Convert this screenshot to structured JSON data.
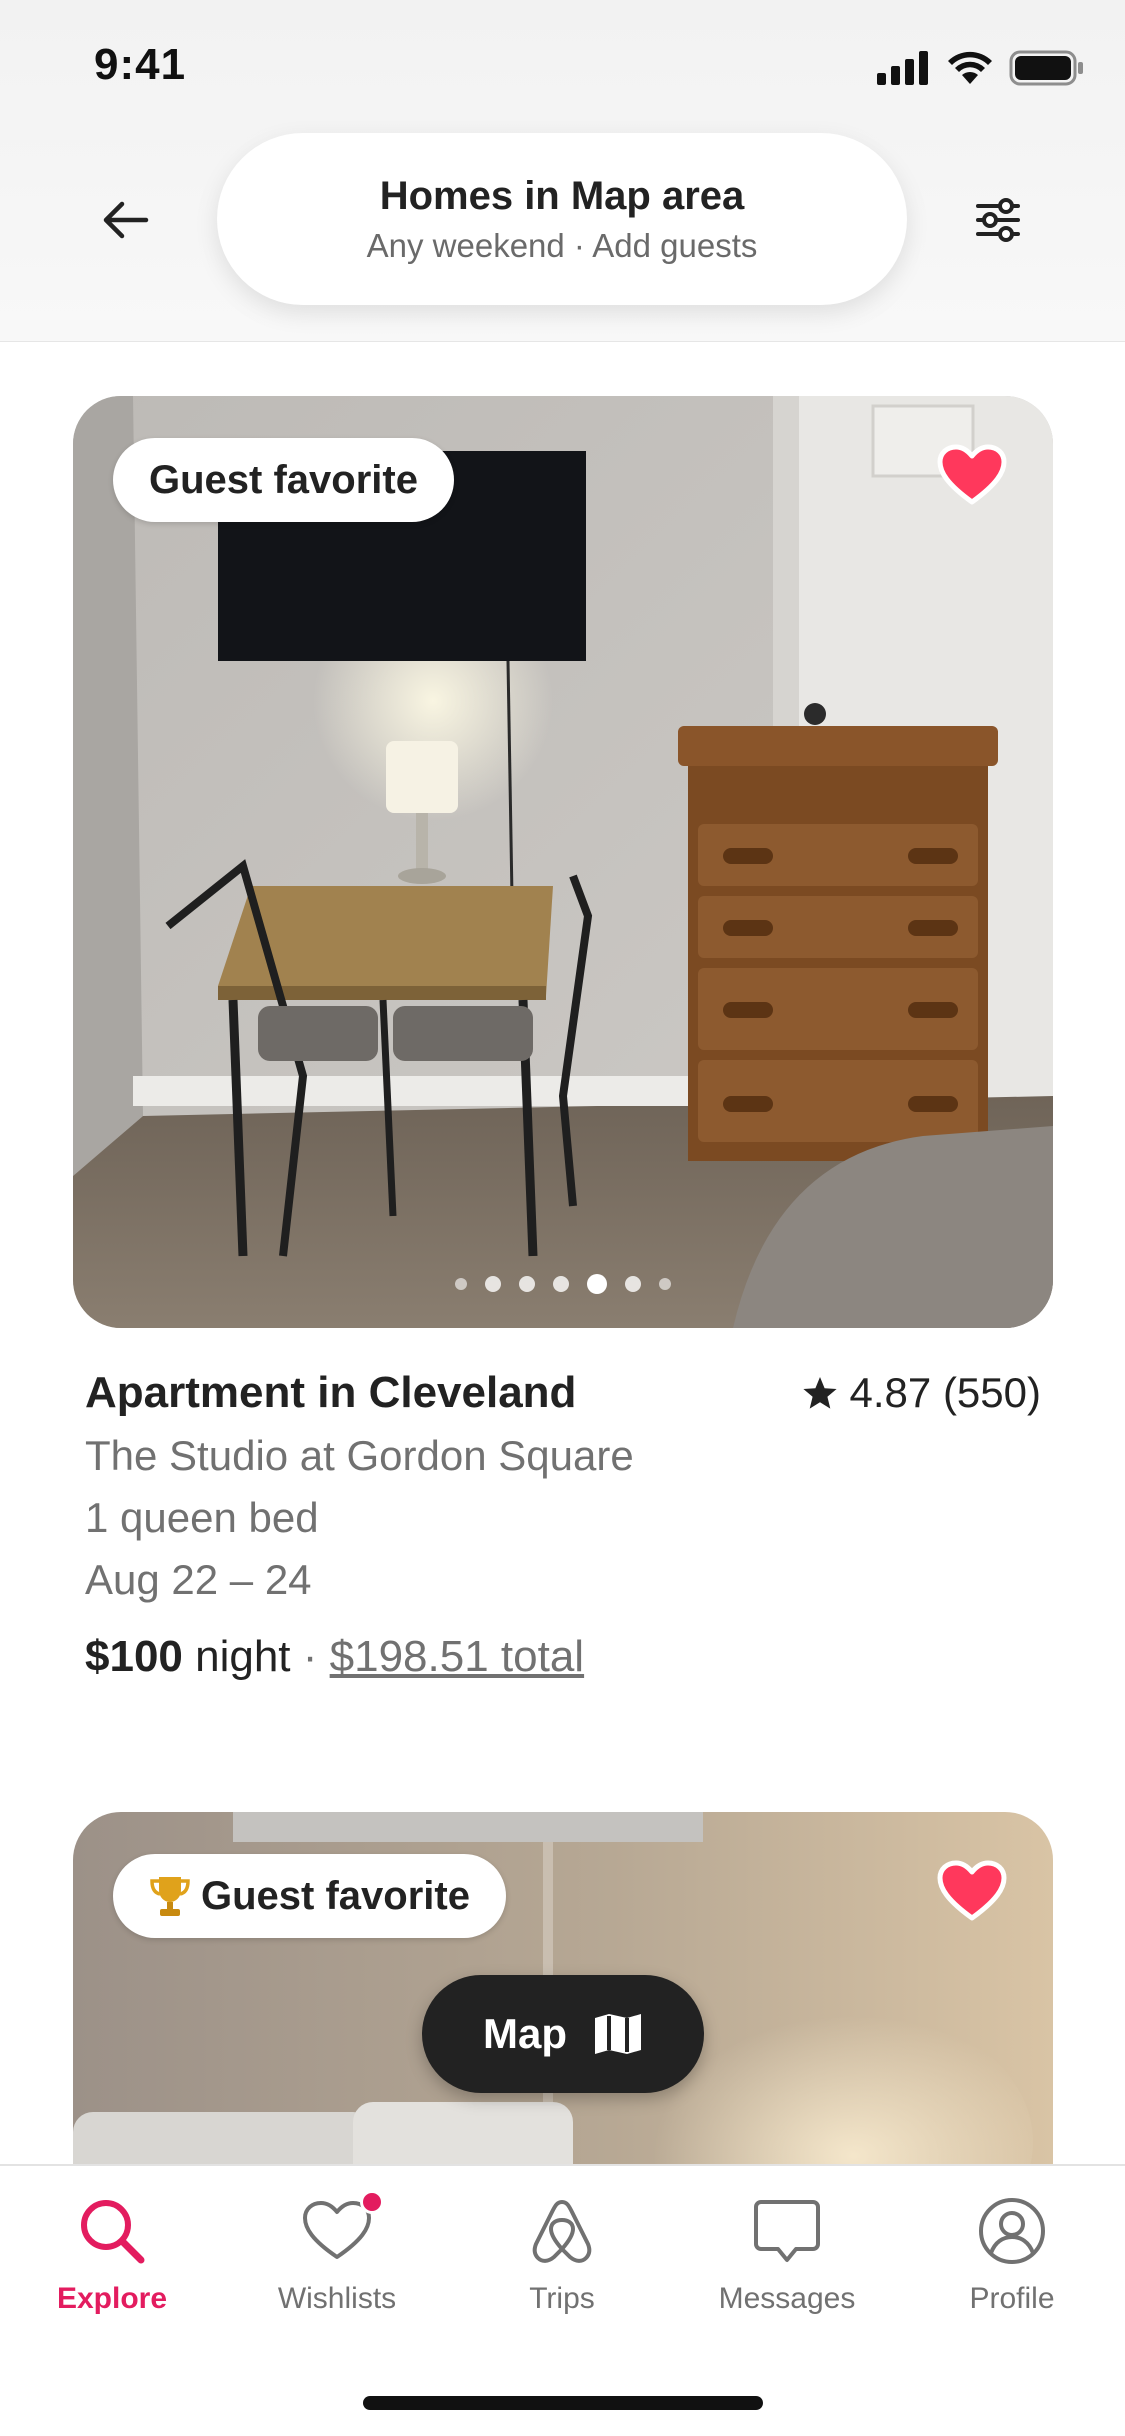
{
  "status_bar": {
    "time": "9:41"
  },
  "header": {
    "title": "Homes in Map area",
    "subtitle": "Any weekend · Add guests"
  },
  "listings": [
    {
      "badge": "Guest favorite",
      "badge_icon": "",
      "favorited": true,
      "photo_count": 7,
      "active_photo": 4,
      "title": "Apartment in Cleveland",
      "rating": "4.87 (550)",
      "name": "The Studio at Gordon Square",
      "beds": "1 queen bed",
      "dates": "Aug 22 – 24",
      "price": "$100",
      "price_unit": " night",
      "separator": " · ",
      "total": "$198.51 total"
    },
    {
      "badge": "Guest favorite",
      "badge_icon": "trophy-icon",
      "favorited": true
    }
  ],
  "map_button": {
    "label": "Map"
  },
  "tabs": [
    {
      "label": "Explore",
      "icon": "search-icon",
      "active": true
    },
    {
      "label": "Wishlists",
      "icon": "heart-icon",
      "active": false,
      "notification": true
    },
    {
      "label": "Trips",
      "icon": "airbnb-logo-icon",
      "active": false
    },
    {
      "label": "Messages",
      "icon": "message-icon",
      "active": false
    },
    {
      "label": "Profile",
      "icon": "profile-icon",
      "active": false
    }
  ],
  "colors": {
    "accent": "#E31C5F",
    "heart": "#FF385C",
    "text": "#222222",
    "muted": "#717171"
  }
}
